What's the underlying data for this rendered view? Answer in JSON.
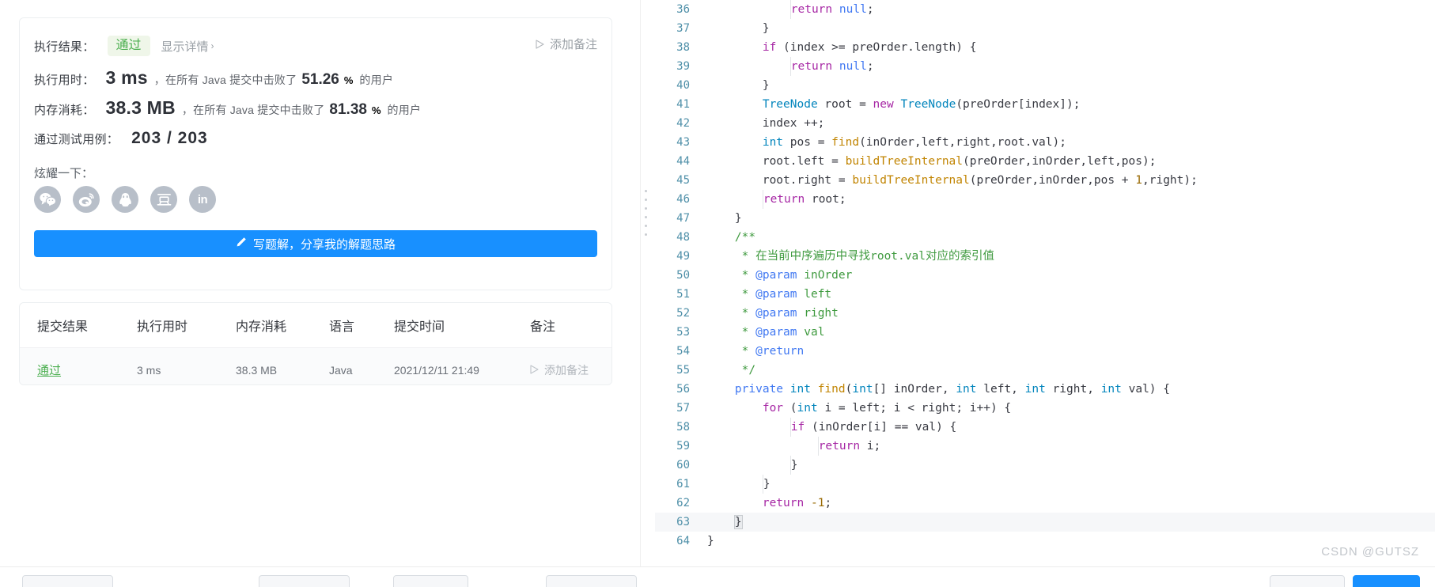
{
  "result_card": {
    "result_label": "执行结果：",
    "result_status": "通过",
    "detail_link": "显示详情",
    "detail_chevron": "›",
    "add_note": "添加备注",
    "runtime_label": "执行用时：",
    "runtime_value": "3 ms",
    "runtime_tail_prefix": "，在所有 Java 提交中击败了",
    "runtime_percent": "51.26",
    "percent_sign": "%",
    "runtime_tail_suffix": "的用户",
    "memory_label": "内存消耗：",
    "memory_value": "38.3 MB",
    "memory_tail_prefix": "，在所有 Java 提交中击败了",
    "memory_percent": "81.38",
    "memory_tail_suffix": "的用户",
    "testcase_label": "通过测试用例：",
    "testcase_value": "203 / 203",
    "flaunt_label": "炫耀一下：",
    "social": [
      {
        "name": "wechat-icon",
        "title": "微信"
      },
      {
        "name": "weibo-icon",
        "title": "微博"
      },
      {
        "name": "qq-icon",
        "title": "QQ"
      },
      {
        "name": "douban-icon",
        "title": "豆瓣"
      },
      {
        "name": "linkedin-icon",
        "title": "in"
      }
    ],
    "solution_button": "写题解，分享我的解题思路",
    "accent_blue": "#1890ff",
    "pass_green": "#4caf50"
  },
  "submissions": {
    "columns": [
      "提交结果",
      "执行用时",
      "内存消耗",
      "语言",
      "提交时间",
      "备注"
    ],
    "rows": [
      {
        "result": "通过",
        "runtime": "3 ms",
        "memory": "38.3 MB",
        "language": "Java",
        "time": "2021/12/11 21:49",
        "note": "添加备注"
      }
    ]
  },
  "code_panel": {
    "watermark": "CSDN @GUTSZ",
    "lines": [
      {
        "n": "36",
        "tokens": [
          {
            "t": "indent",
            "v": "            "
          },
          {
            "t": "bar",
            "v": ""
          },
          {
            "t": "kw",
            "v": "return"
          },
          {
            "t": "pun",
            "v": " "
          },
          {
            "t": "kw2",
            "v": "null"
          },
          {
            "t": "pun",
            "v": ";"
          }
        ]
      },
      {
        "n": "37",
        "tokens": [
          {
            "t": "indent",
            "v": "        "
          },
          {
            "t": "pun",
            "v": "}"
          }
        ]
      },
      {
        "n": "38",
        "tokens": [
          {
            "t": "indent",
            "v": "        "
          },
          {
            "t": "kw",
            "v": "if"
          },
          {
            "t": "pun",
            "v": " (index >= preOrder.length) {"
          }
        ]
      },
      {
        "n": "39",
        "tokens": [
          {
            "t": "indent",
            "v": "            "
          },
          {
            "t": "bar",
            "v": ""
          },
          {
            "t": "kw",
            "v": "return"
          },
          {
            "t": "pun",
            "v": " "
          },
          {
            "t": "kw2",
            "v": "null"
          },
          {
            "t": "pun",
            "v": ";"
          }
        ]
      },
      {
        "n": "40",
        "tokens": [
          {
            "t": "indent",
            "v": "        "
          },
          {
            "t": "pun",
            "v": "}"
          }
        ]
      },
      {
        "n": "41",
        "tokens": [
          {
            "t": "indent",
            "v": "        "
          },
          {
            "t": "typ",
            "v": "TreeNode"
          },
          {
            "t": "pun",
            "v": " root = "
          },
          {
            "t": "kw",
            "v": "new"
          },
          {
            "t": "pun",
            "v": " "
          },
          {
            "t": "typ",
            "v": "TreeNode"
          },
          {
            "t": "pun",
            "v": "(preOrder[index]);"
          }
        ]
      },
      {
        "n": "42",
        "tokens": [
          {
            "t": "indent",
            "v": "        "
          },
          {
            "t": "pun",
            "v": "index ++;"
          }
        ]
      },
      {
        "n": "43",
        "tokens": [
          {
            "t": "indent",
            "v": "        "
          },
          {
            "t": "typ",
            "v": "int"
          },
          {
            "t": "pun",
            "v": " pos = "
          },
          {
            "t": "fn",
            "v": "find"
          },
          {
            "t": "pun",
            "v": "(inOrder,left,right,root.val);"
          }
        ]
      },
      {
        "n": "44",
        "tokens": [
          {
            "t": "indent",
            "v": "        "
          },
          {
            "t": "pun",
            "v": "root.left = "
          },
          {
            "t": "fn",
            "v": "buildTreeInternal"
          },
          {
            "t": "pun",
            "v": "(preOrder,inOrder,left,pos);"
          }
        ]
      },
      {
        "n": "45",
        "tokens": [
          {
            "t": "indent",
            "v": "        "
          },
          {
            "t": "pun",
            "v": "root.right = "
          },
          {
            "t": "fn",
            "v": "buildTreeInternal"
          },
          {
            "t": "pun",
            "v": "(preOrder,inOrder,pos + "
          },
          {
            "t": "num",
            "v": "1"
          },
          {
            "t": "pun",
            "v": ",right);"
          }
        ]
      },
      {
        "n": "46",
        "tokens": [
          {
            "t": "indent",
            "v": "        "
          },
          {
            "t": "bar",
            "v": ""
          },
          {
            "t": "kw",
            "v": "return"
          },
          {
            "t": "pun",
            "v": " root;"
          }
        ]
      },
      {
        "n": "47",
        "tokens": [
          {
            "t": "indent",
            "v": "    "
          },
          {
            "t": "pun",
            "v": "}"
          }
        ]
      },
      {
        "n": "48",
        "tokens": [
          {
            "t": "indent",
            "v": "    "
          },
          {
            "t": "cmt",
            "v": "/**"
          }
        ]
      },
      {
        "n": "49",
        "tokens": [
          {
            "t": "indent",
            "v": "     "
          },
          {
            "t": "cmt",
            "v": "* 在当前中序遍历中寻找root.val对应的索引值"
          }
        ]
      },
      {
        "n": "50",
        "tokens": [
          {
            "t": "indent",
            "v": "     "
          },
          {
            "t": "cmt",
            "v": "* "
          },
          {
            "t": "tag",
            "v": "@param"
          },
          {
            "t": "cmt",
            "v": " inOrder"
          }
        ]
      },
      {
        "n": "51",
        "tokens": [
          {
            "t": "indent",
            "v": "     "
          },
          {
            "t": "cmt",
            "v": "* "
          },
          {
            "t": "tag",
            "v": "@param"
          },
          {
            "t": "cmt",
            "v": " left"
          }
        ]
      },
      {
        "n": "52",
        "tokens": [
          {
            "t": "indent",
            "v": "     "
          },
          {
            "t": "cmt",
            "v": "* "
          },
          {
            "t": "tag",
            "v": "@param"
          },
          {
            "t": "cmt",
            "v": " right"
          }
        ]
      },
      {
        "n": "53",
        "tokens": [
          {
            "t": "indent",
            "v": "     "
          },
          {
            "t": "cmt",
            "v": "* "
          },
          {
            "t": "tag",
            "v": "@param"
          },
          {
            "t": "cmt",
            "v": " val"
          }
        ]
      },
      {
        "n": "54",
        "tokens": [
          {
            "t": "indent",
            "v": "     "
          },
          {
            "t": "cmt",
            "v": "* "
          },
          {
            "t": "tag",
            "v": "@return"
          }
        ]
      },
      {
        "n": "55",
        "tokens": [
          {
            "t": "indent",
            "v": "     "
          },
          {
            "t": "cmt",
            "v": "*/"
          }
        ]
      },
      {
        "n": "56",
        "tokens": [
          {
            "t": "indent",
            "v": "    "
          },
          {
            "t": "kw2",
            "v": "private"
          },
          {
            "t": "pun",
            "v": " "
          },
          {
            "t": "typ",
            "v": "int"
          },
          {
            "t": "pun",
            "v": " "
          },
          {
            "t": "fn",
            "v": "find"
          },
          {
            "t": "pun",
            "v": "("
          },
          {
            "t": "typ",
            "v": "int"
          },
          {
            "t": "pun",
            "v": "[] inOrder, "
          },
          {
            "t": "typ",
            "v": "int"
          },
          {
            "t": "pun",
            "v": " left, "
          },
          {
            "t": "typ",
            "v": "int"
          },
          {
            "t": "pun",
            "v": " right, "
          },
          {
            "t": "typ",
            "v": "int"
          },
          {
            "t": "pun",
            "v": " val) {"
          }
        ]
      },
      {
        "n": "57",
        "tokens": [
          {
            "t": "indent",
            "v": "        "
          },
          {
            "t": "kw",
            "v": "for"
          },
          {
            "t": "pun",
            "v": " ("
          },
          {
            "t": "typ",
            "v": "int"
          },
          {
            "t": "pun",
            "v": " i = left; i < right; i++) {"
          }
        ]
      },
      {
        "n": "58",
        "tokens": [
          {
            "t": "indent",
            "v": "            "
          },
          {
            "t": "bar",
            "v": ""
          },
          {
            "t": "kw",
            "v": "if"
          },
          {
            "t": "pun",
            "v": " (inOrder[i] == val) {"
          }
        ]
      },
      {
        "n": "59",
        "tokens": [
          {
            "t": "indent",
            "v": "                "
          },
          {
            "t": "bar",
            "v": ""
          },
          {
            "t": "kw",
            "v": "return"
          },
          {
            "t": "pun",
            "v": " i;"
          }
        ]
      },
      {
        "n": "60",
        "tokens": [
          {
            "t": "indent",
            "v": "            "
          },
          {
            "t": "bar",
            "v": ""
          },
          {
            "t": "pun",
            "v": "}"
          }
        ]
      },
      {
        "n": "61",
        "tokens": [
          {
            "t": "indent",
            "v": "        "
          },
          {
            "t": "bar",
            "v": ""
          },
          {
            "t": "pun",
            "v": "}"
          }
        ]
      },
      {
        "n": "62",
        "tokens": [
          {
            "t": "indent",
            "v": "        "
          },
          {
            "t": "kw",
            "v": "return"
          },
          {
            "t": "pun",
            "v": " "
          },
          {
            "t": "num",
            "v": "-1"
          },
          {
            "t": "pun",
            "v": ";"
          }
        ]
      },
      {
        "n": "63",
        "tokens": [
          {
            "t": "indent",
            "v": "    "
          },
          {
            "t": "box",
            "v": "}"
          }
        ],
        "hl": true
      },
      {
        "n": "64",
        "tokens": [
          {
            "t": "pun",
            "v": "}"
          }
        ]
      }
    ]
  }
}
